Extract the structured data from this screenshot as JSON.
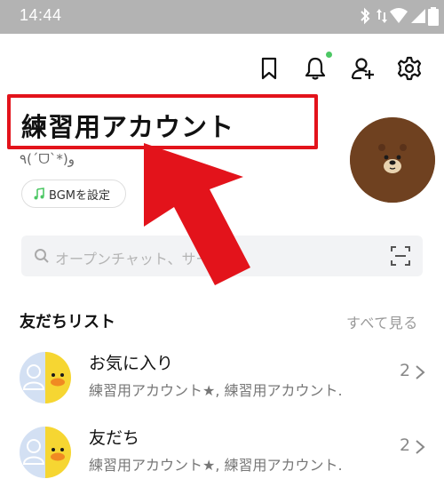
{
  "status_bar": {
    "time": "14:44",
    "icons": [
      "bluetooth-icon",
      "data-arrows-icon",
      "wifi-icon",
      "signal-icon",
      "battery-icon"
    ]
  },
  "header": {
    "icons": [
      "bookmark-icon",
      "bell-icon",
      "add-friend-icon",
      "gear-icon"
    ],
    "notification_dot_color": "#4cc764"
  },
  "profile": {
    "name": "練習用アカウント",
    "status_message": "٩(ˊᗜˋ*)و",
    "bgm_button_label": "BGMを設定",
    "highlight_color": "#e3131b"
  },
  "search": {
    "placeholder": "オープンチャット、サービス"
  },
  "friends_section": {
    "title": "友だちリスト",
    "see_all": "すべて見る",
    "rows": [
      {
        "title": "お気に入り",
        "subtitle": "練習用アカウント★, 練習用アカウント.",
        "count": "2"
      },
      {
        "title": "友だち",
        "subtitle": "練習用アカウント★, 練習用アカウント.",
        "count": "2"
      }
    ]
  }
}
